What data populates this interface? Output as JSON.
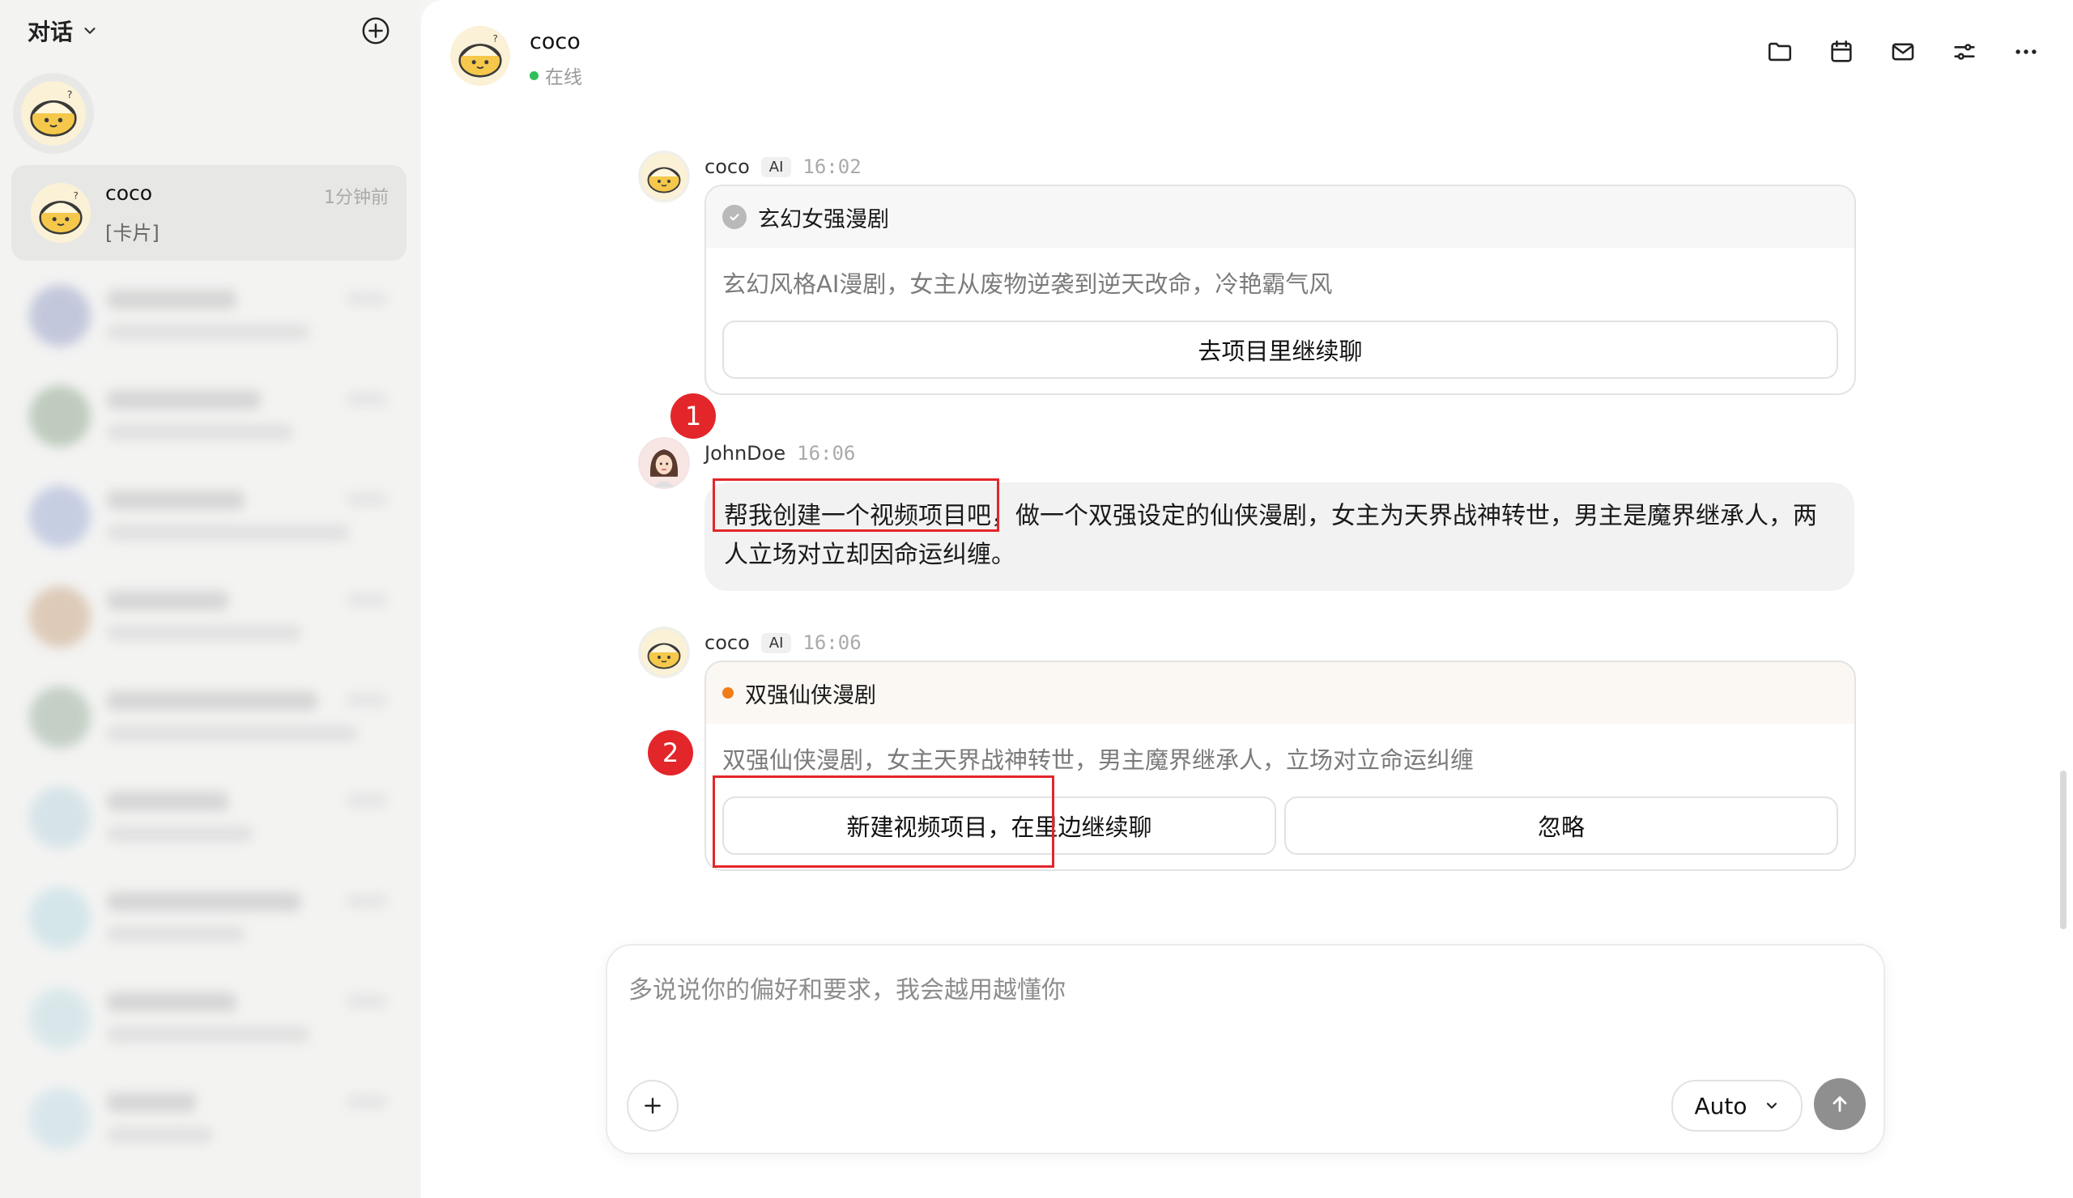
{
  "sidebar": {
    "title": "对话",
    "conversation": {
      "name": "coco",
      "preview": "[卡片]",
      "time": "1分钟前"
    }
  },
  "header": {
    "name": "coco",
    "status": "在线"
  },
  "header_icons": [
    "folder-icon",
    "calendar-icon",
    "mail-icon",
    "settings-sliders-icon",
    "more-icon"
  ],
  "messages": [
    {
      "sender": "coco",
      "badge": "AI",
      "time": "16:02",
      "card": {
        "title": "玄幻女强漫剧",
        "description": "玄幻风格AI漫剧，女主从废物逆袭到逆天改命，冷艳霸气风",
        "button": "去项目里继续聊"
      }
    },
    {
      "sender": "JohnDoe",
      "time": "16:06",
      "text": "帮我创建一个视频项目吧，做一个双强设定的仙侠漫剧，女主为天界战神转世，男主是魔界继承人，两人立场对立却因命运纠缠。"
    },
    {
      "sender": "coco",
      "badge": "AI",
      "time": "16:06",
      "card": {
        "title": "双强仙侠漫剧",
        "description": "双强仙侠漫剧，女主天界战神转世，男主魔界继承人，立场对立命运纠缠",
        "button_primary": "新建视频项目，在里边继续聊",
        "button_secondary": "忽略"
      }
    }
  ],
  "annotations": {
    "marker1": "1",
    "marker2": "2"
  },
  "composer": {
    "placeholder": "多说说你的偏好和要求，我会越用越懂你",
    "mode": "Auto"
  },
  "colors": {
    "accent_red": "#e3262a",
    "online_green": "#2fbf5a",
    "pending_orange": "#f07d1a"
  }
}
